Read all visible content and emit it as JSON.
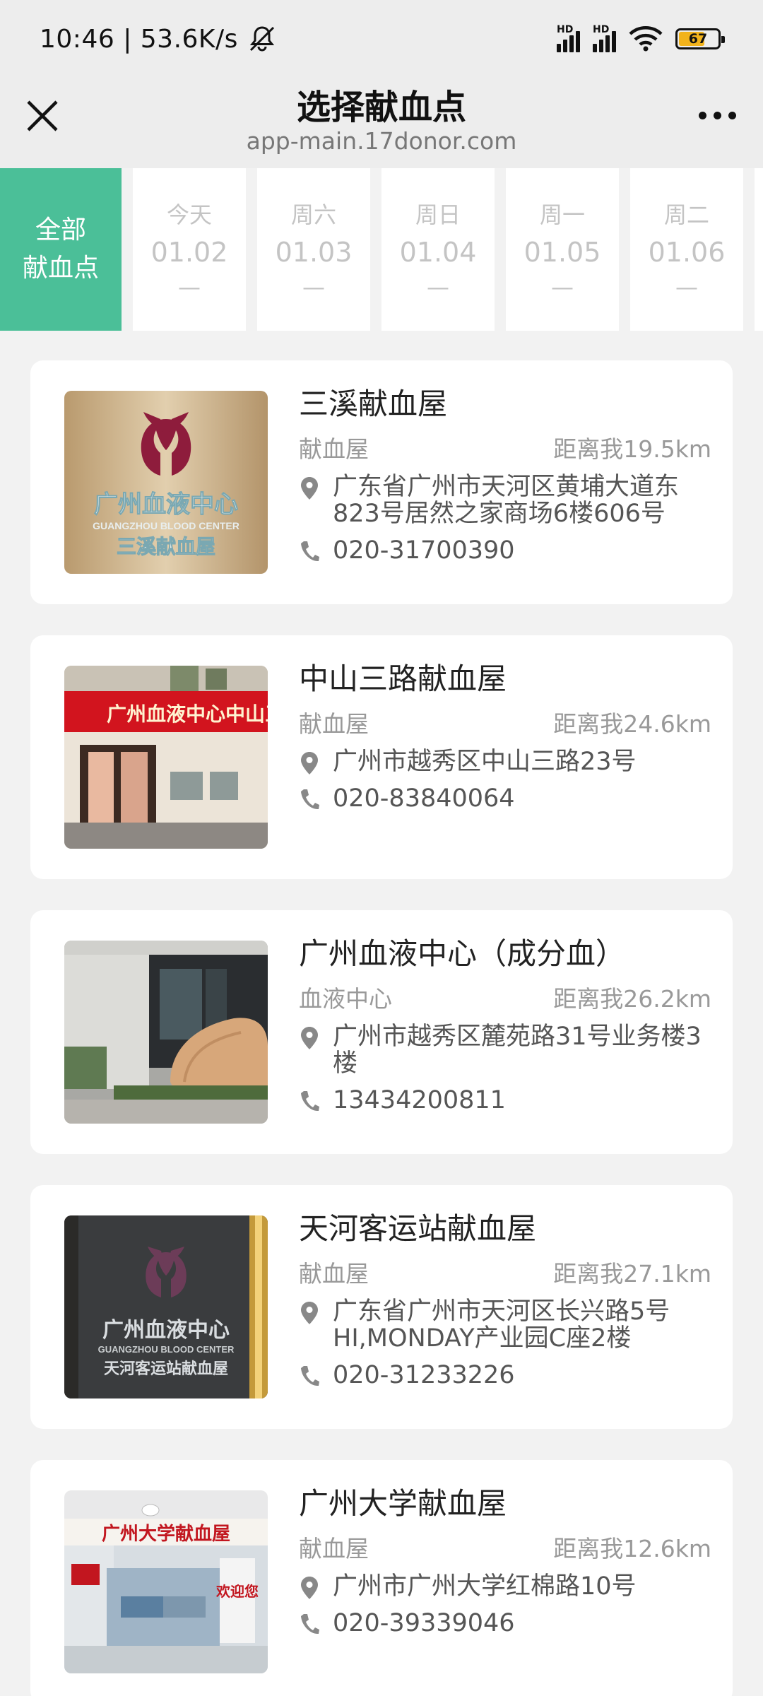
{
  "status_bar": {
    "time_speed": "10:46 | 53.6K/s",
    "battery_level": "67",
    "battery_fraction": 0.67,
    "icons": [
      "mute-bell-icon",
      "signal-hd-icon",
      "signal-hd-icon",
      "wifi-icon",
      "battery-icon"
    ]
  },
  "nav": {
    "title": "选择献血点",
    "url": "app-main.17donor.com",
    "close_icon": "close-icon",
    "more_icon": "more-icon"
  },
  "date_tabs": {
    "all": {
      "line1": "全部",
      "line2": "献血点"
    },
    "days": [
      {
        "weekday": "今天",
        "date": "01.02",
        "status": "—"
      },
      {
        "weekday": "周六",
        "date": "01.03",
        "status": "—"
      },
      {
        "weekday": "周日",
        "date": "01.04",
        "status": "—"
      },
      {
        "weekday": "周一",
        "date": "01.05",
        "status": "—"
      },
      {
        "weekday": "周二",
        "date": "01.06",
        "status": "—"
      }
    ],
    "accent_color": "#4bbf98"
  },
  "sites": [
    {
      "name": "三溪献血屋",
      "type": "献血屋",
      "distance": "距离我19.5km",
      "address": "广东省广州市天河区黄埔大道东823号居然之家商场6楼606号",
      "phone": "020-31700390",
      "photo_caption_main": "广州血液中心",
      "photo_caption_en": "GUANGZHOU BLOOD CENTER",
      "photo_caption_sub": "三溪献血屋"
    },
    {
      "name": "中山三路献血屋",
      "type": "献血屋",
      "distance": "距离我24.6km",
      "address": "广州市越秀区中山三路23号",
      "phone": "020-83840064",
      "photo_caption_main": "广州血液中心中山三",
      "photo_caption_en": "",
      "photo_caption_sub": ""
    },
    {
      "name": "广州血液中心（成分血）",
      "type": "血液中心",
      "distance": "距离我26.2km",
      "address": "广州市越秀区麓苑路31号业务楼3楼",
      "phone": "13434200811",
      "photo_caption_main": "",
      "photo_caption_en": "",
      "photo_caption_sub": ""
    },
    {
      "name": "天河客运站献血屋",
      "type": "献血屋",
      "distance": "距离我27.1km",
      "address": "广东省广州市天河区长兴路5号HI,MONDAY产业园C座2楼",
      "phone": "020-31233226",
      "photo_caption_main": "广州血液中心",
      "photo_caption_en": "GUANGZHOU BLOOD CENTER",
      "photo_caption_sub": "天河客运站献血屋"
    },
    {
      "name": "广州大学献血屋",
      "type": "献血屋",
      "distance": "距离我12.6km",
      "address": "广州市广州大学红棉路10号",
      "phone": "020-39339046",
      "photo_caption_main": "广州大学献血屋",
      "photo_caption_en": "",
      "photo_caption_sub": "欢迎您"
    }
  ]
}
